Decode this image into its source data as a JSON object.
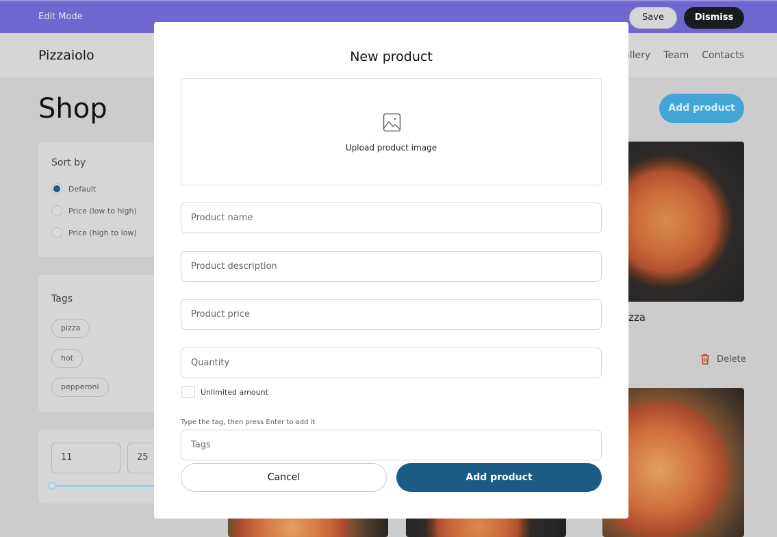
{
  "topbar": {
    "mode_label": "Edit Mode",
    "save_label": "Save",
    "dismiss_label": "Dismiss"
  },
  "nav": {
    "logo": "Pizzaiolo",
    "links": [
      "allery",
      "Team",
      "Contacts"
    ]
  },
  "shop": {
    "title": "Shop",
    "add_product_label": "Add product"
  },
  "sort": {
    "title": "Sort by",
    "options": [
      {
        "label": "Default",
        "selected": true
      },
      {
        "label": "Price (low to high)",
        "selected": false
      },
      {
        "label": "Price (high to low)",
        "selected": false
      }
    ]
  },
  "tags": {
    "title": "Tags",
    "items": [
      "pizza",
      "hot",
      "pepperoni"
    ]
  },
  "price": {
    "min": "11",
    "max": "25"
  },
  "product": {
    "name_partial": "zza",
    "delete_label": "Delete"
  },
  "colors": {
    "topbar": "#6f66d0",
    "primary": "#1b5b86",
    "accent": "#41a5d6",
    "delete": "#c0392b"
  },
  "modal": {
    "title": "New product",
    "upload_label": "Upload product image",
    "name_placeholder": "Product name",
    "description_placeholder": "Product description",
    "price_placeholder": "Product price",
    "quantity_placeholder": "Quantity",
    "unlimited_label": "Unlimited amount",
    "tags_hint": "Type the tag, then press Enter to add it",
    "tags_placeholder": "Tags",
    "cancel_label": "Cancel",
    "submit_label": "Add product"
  }
}
